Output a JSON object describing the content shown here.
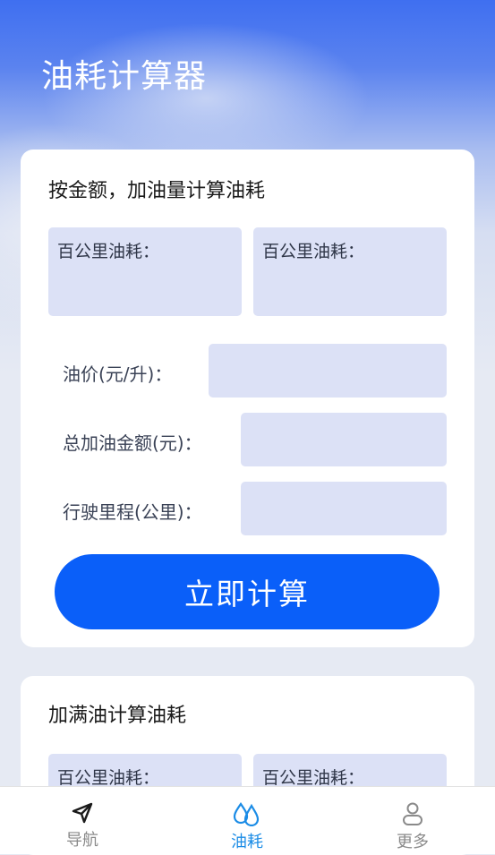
{
  "header": {
    "title": "油耗计算器"
  },
  "card1": {
    "title": "按金额，加油量计算油耗",
    "results": [
      "百公里油耗：",
      "百公里油耗："
    ],
    "fields": [
      {
        "label": "油价(元/升)：",
        "value": ""
      },
      {
        "label": "总加油金额(元)：",
        "value": ""
      },
      {
        "label": "行驶里程(公里)：",
        "value": ""
      }
    ],
    "button": "立即计算"
  },
  "card2": {
    "title": "加满油计算油耗",
    "results": [
      "百公里油耗：",
      "百公里油耗："
    ]
  },
  "tabbar": {
    "items": [
      {
        "label": "导航",
        "icon": "navigation-arrow-icon",
        "active": false
      },
      {
        "label": "油耗",
        "icon": "fuel-drops-icon",
        "active": true
      },
      {
        "label": "更多",
        "icon": "person-icon",
        "active": false
      }
    ]
  },
  "colors": {
    "primary": "#0a5ff9",
    "active_tab": "#1b8ce6",
    "input_bg": "#dce1f6",
    "inactive_tab": "#8a8a8a"
  }
}
